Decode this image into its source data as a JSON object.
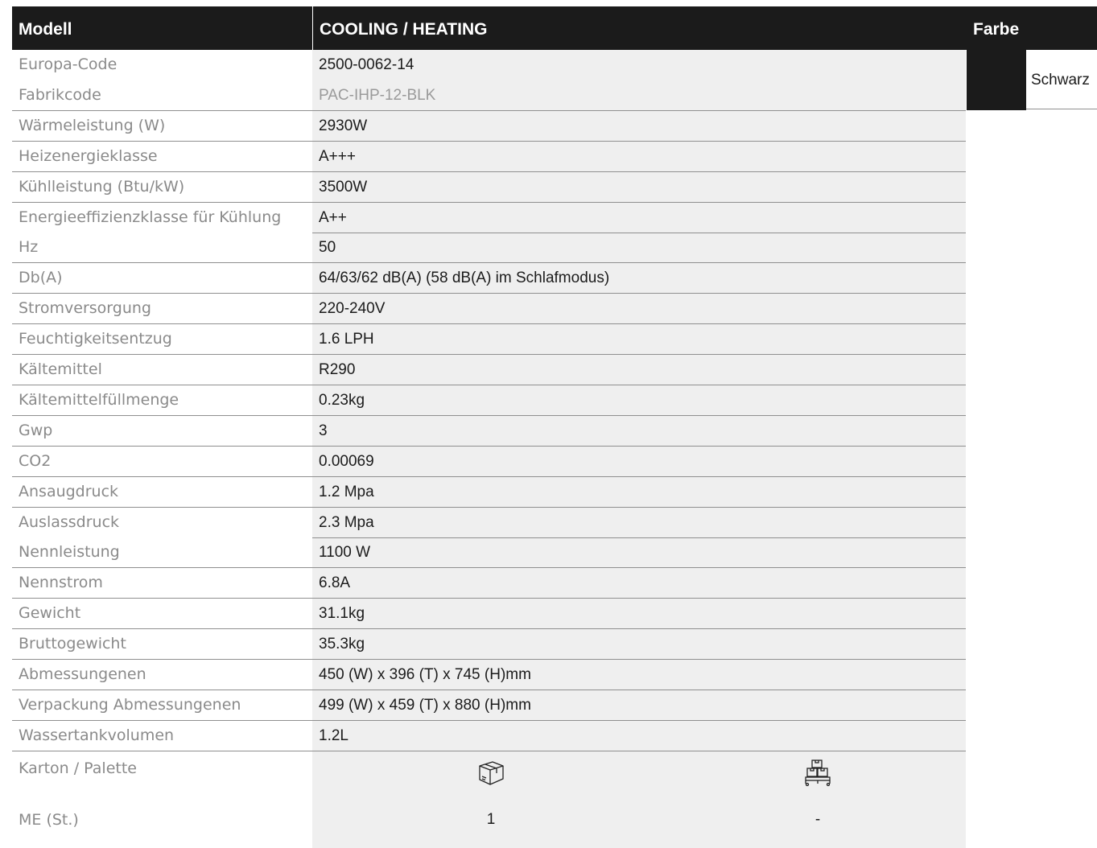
{
  "header": {
    "model_label": "Modell",
    "type_label": "COOLING / HEATING",
    "color_label": "Farbe"
  },
  "color": {
    "swatch": "#1b1b1b",
    "name": "Schwarz"
  },
  "rows": [
    {
      "label": "Europa-Code",
      "value": "2500-0062-14"
    },
    {
      "label": "Fabrikcode",
      "value": "PAC-IHP-12-BLK"
    },
    {
      "label": "Wärmeleistung (W)",
      "value": "2930W"
    },
    {
      "label": "Heizenergieklasse",
      "value": "A+++"
    },
    {
      "label": "Kühlleistung (Btu/kW)",
      "value": "3500W"
    },
    {
      "label": "Energieeffizienzklasse für Kühlung",
      "value": "A++"
    },
    {
      "label": "Hz",
      "value": "50"
    },
    {
      "label": "Db(A)",
      "value": "64/63/62 dB(A) (58 dB(A) im Schlafmodus)"
    },
    {
      "label": "Stromversorgung",
      "value": "220-240V"
    },
    {
      "label": "Feuchtigkeitsentzug",
      "value": "1.6 LPH"
    },
    {
      "label": "Kältemittel",
      "value": "R290"
    },
    {
      "label": "Kältemittelfüllmenge",
      "value": "0.23kg"
    },
    {
      "label": "Gwp",
      "value": "3"
    },
    {
      "label": "CO2",
      "value": "0.00069"
    },
    {
      "label": "Ansaugdruck",
      "value": "1.2 Mpa"
    },
    {
      "label": "Auslassdruck",
      "value": "2.3 Mpa"
    },
    {
      "label": "Nennleistung",
      "value": "1100 W"
    },
    {
      "label": "Nennstrom",
      "value": "6.8A"
    },
    {
      "label": "Gewicht",
      "value": "31.1kg"
    },
    {
      "label": "Bruttogewicht",
      "value": "35.3kg"
    },
    {
      "label": "Abmessungenen",
      "value": "450 (W) x 396 (T) x 745 (H)mm"
    },
    {
      "label": "Verpackung Abmessungenen",
      "value": "499 (W) x 459 (T) x 880 (H)mm"
    },
    {
      "label": "Wassertankvolumen",
      "value": "1.2L"
    }
  ],
  "packaging": {
    "label": "Karton / Palette",
    "me_label": "ME (St.)",
    "carton_icon": "box-icon",
    "pallet_icon": "pallet-icon",
    "carton_me": "1",
    "pallet_me": "-"
  }
}
